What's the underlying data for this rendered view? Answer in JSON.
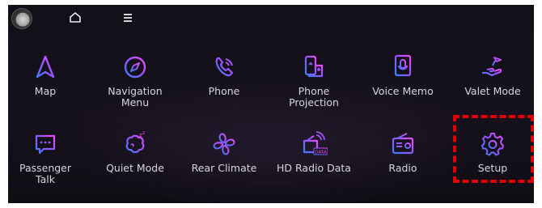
{
  "apps_row1": [
    {
      "label": "Map",
      "icon": "map-arrow-icon"
    },
    {
      "label": "Navigation\nMenu",
      "icon": "compass-icon"
    },
    {
      "label": "Phone",
      "icon": "phone-icon"
    },
    {
      "label": "Phone\nProjection",
      "icon": "phone-projection-icon"
    },
    {
      "label": "Voice Memo",
      "icon": "voice-memo-icon"
    },
    {
      "label": "Valet Mode",
      "icon": "valet-hand-icon"
    }
  ],
  "apps_row2": [
    {
      "label": "Passenger\nTalk",
      "icon": "passenger-talk-icon"
    },
    {
      "label": "Quiet Mode",
      "icon": "quiet-mode-icon"
    },
    {
      "label": "Rear Climate",
      "icon": "fan-icon"
    },
    {
      "label": "HD Radio Data",
      "icon": "hd-radio-data-icon"
    },
    {
      "label": "Radio",
      "icon": "radio-icon"
    },
    {
      "label": "Setup",
      "icon": "gear-icon"
    }
  ],
  "data_badge": "DATA",
  "colors": {
    "icon_gradient_start": "#3f7dff",
    "icon_gradient_end": "#e04bff",
    "highlight": "#e00000",
    "label": "#d6d6dc"
  }
}
